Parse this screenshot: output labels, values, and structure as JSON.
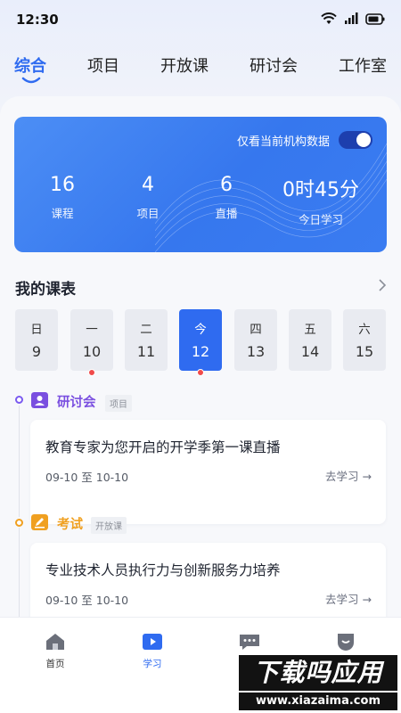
{
  "status_bar": {
    "time": "12:30",
    "icons": [
      "wifi-icon",
      "signal-icon",
      "battery-icon"
    ]
  },
  "top_tabs": [
    {
      "label": "综合",
      "active": true
    },
    {
      "label": "项目",
      "active": false
    },
    {
      "label": "开放课",
      "active": false
    },
    {
      "label": "研讨会",
      "active": false
    },
    {
      "label": "工作室",
      "active": false
    }
  ],
  "stats_card": {
    "filter_label": "仅看当前机构数据",
    "filter_on": true,
    "stats": [
      {
        "value": "16",
        "label": "课程"
      },
      {
        "value": "4",
        "label": "项目"
      },
      {
        "value": "6",
        "label": "直播"
      },
      {
        "value": "0时45分",
        "label": "今日学习"
      }
    ]
  },
  "schedule": {
    "title": "我的课表",
    "more_icon": "chevron-right-icon",
    "days": [
      {
        "weekday": "日",
        "date": "9",
        "active": false,
        "has_event": false
      },
      {
        "weekday": "一",
        "date": "10",
        "active": false,
        "has_event": true
      },
      {
        "weekday": "二",
        "date": "11",
        "active": false,
        "has_event": false
      },
      {
        "weekday": "今",
        "date": "12",
        "active": true,
        "has_event": true
      },
      {
        "weekday": "四",
        "date": "13",
        "active": false,
        "has_event": false
      },
      {
        "weekday": "五",
        "date": "14",
        "active": false,
        "has_event": false
      },
      {
        "weekday": "六",
        "date": "15",
        "active": false,
        "has_event": false
      }
    ],
    "entries": [
      {
        "type_label": "研讨会",
        "type_color": "#7a4fe0",
        "type_icon": "person-card-icon",
        "tag": "项目",
        "course_title": "教育专家为您开启的开学季第一课直播",
        "date_range": "09-10 至 10-10",
        "action": "去学习 →"
      },
      {
        "type_label": "考试",
        "type_color": "#f0a020",
        "type_icon": "edit-icon",
        "tag": "开放课",
        "course_title": "专业技术人员执行力与创新服务力培养",
        "date_range": "09-10 至 10-10",
        "action": "去学习 →"
      }
    ]
  },
  "bottom_nav": [
    {
      "label": "首页",
      "icon": "home-icon",
      "active": false
    },
    {
      "label": "学习",
      "icon": "play-icon",
      "active": true
    },
    {
      "label": "",
      "icon": "chat-icon",
      "active": false
    },
    {
      "label": "",
      "icon": "profile-icon",
      "active": false
    }
  ],
  "watermark": {
    "main": "下载吗应用",
    "sub": "www.xiazaima.com"
  },
  "colors": {
    "accent": "#2f6bf0",
    "dot": "#f04b4b",
    "seminar": "#7a4fe0",
    "exam": "#f0a020"
  }
}
